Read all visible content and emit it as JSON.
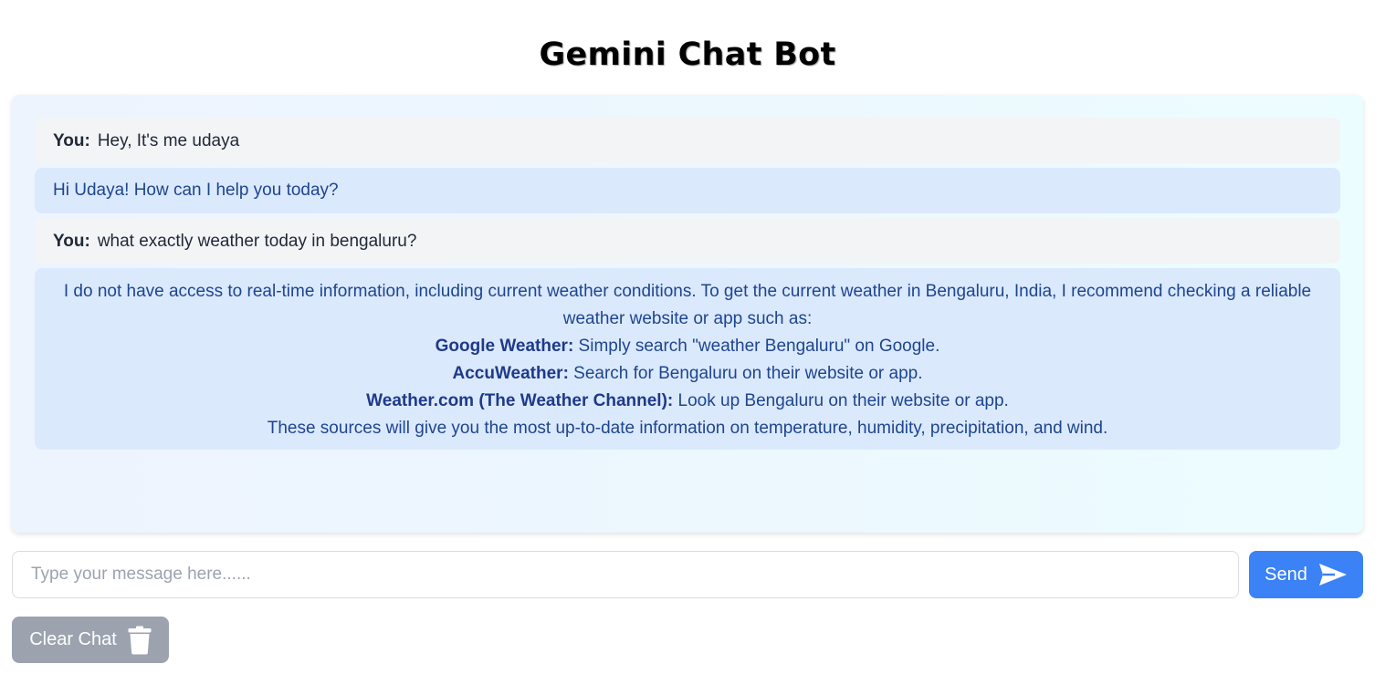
{
  "header": {
    "title": "Gemini Chat Bot"
  },
  "chat": {
    "you_label": "You:",
    "messages": [
      {
        "role": "user",
        "text": "Hey, It's me udaya"
      },
      {
        "role": "bot",
        "text": "Hi Udaya! How can I help you today?"
      },
      {
        "role": "user",
        "text": "what exactly weather today in bengaluru?"
      },
      {
        "role": "bot",
        "intro": "I do not have access to real-time information, including current weather conditions. To get the current weather in Bengaluru, India, I recommend checking a reliable weather website or app such as:",
        "items": [
          {
            "name": "Google Weather:",
            "text": " Simply search \"weather Bengaluru\" on Google."
          },
          {
            "name": "AccuWeather:",
            "text": " Search for Bengaluru on their website or app."
          },
          {
            "name": "Weather.com (The Weather Channel):",
            "text": " Look up Bengaluru on their website or app."
          }
        ],
        "outro": "These sources will give you the most up-to-date information on temperature, humidity, precipitation, and wind."
      }
    ]
  },
  "composer": {
    "placeholder": "Type your message here......",
    "value": "",
    "send_label": "Send",
    "send_icon": "paper-plane-icon"
  },
  "actions": {
    "clear_label": "Clear Chat",
    "clear_icon": "trash-icon"
  },
  "colors": {
    "send_button": "#3b82f6",
    "clear_button": "#9ca3af",
    "user_bubble": "#f3f4f6",
    "bot_bubble": "#dbe9fd",
    "bot_text": "#1e4590"
  }
}
